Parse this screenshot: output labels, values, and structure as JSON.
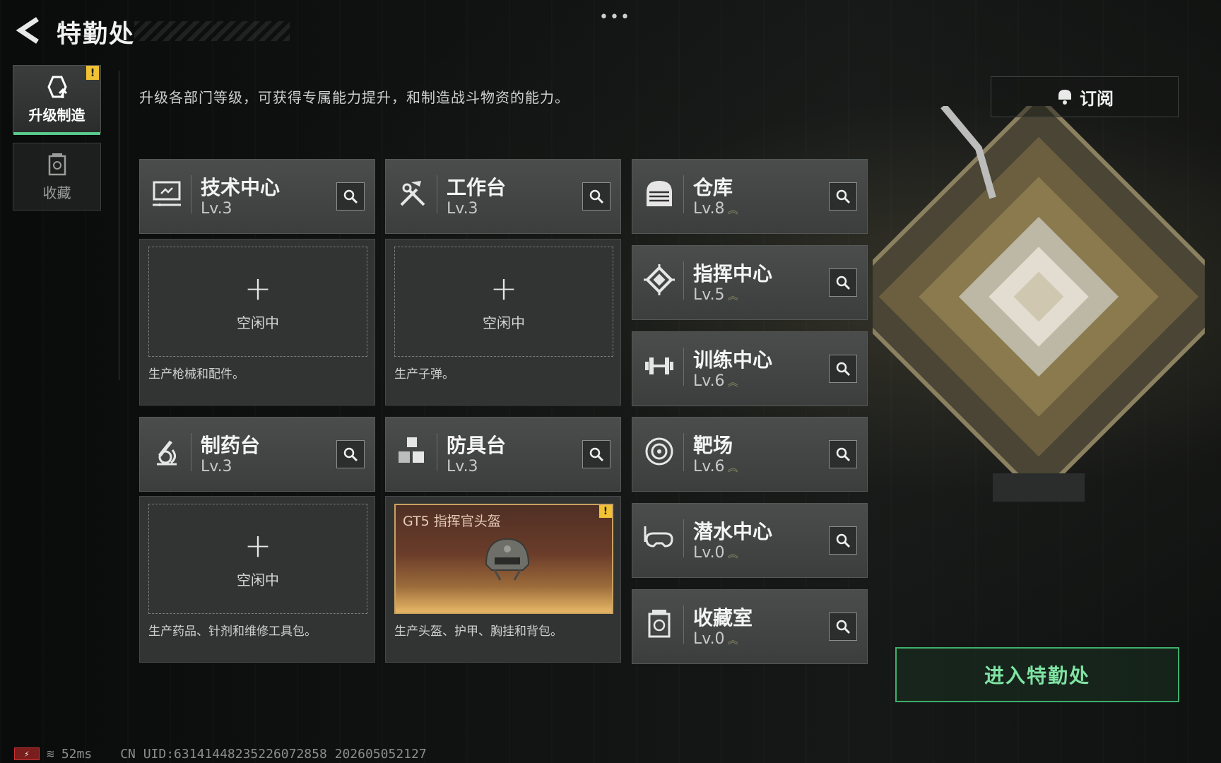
{
  "header": {
    "title": "特勤处",
    "more_dots": "•••"
  },
  "tabs": [
    {
      "label": "升级制造",
      "active": true,
      "warning": "!"
    },
    {
      "label": "收藏",
      "active": false
    }
  ],
  "description": "升级各部门等级，可获得专属能力提升，和制造战斗物资的能力。",
  "subscribe_label": "订阅",
  "enter_label": "进入特勤处",
  "stations": [
    {
      "name": "技术中心",
      "level": "Lv.3",
      "icon": "computer-icon",
      "slot_status": "空闲中",
      "slot_desc": "生产枪械和配件。"
    },
    {
      "name": "工作台",
      "level": "Lv.3",
      "icon": "tools-icon",
      "slot_status": "空闲中",
      "slot_desc": "生产子弹。"
    },
    {
      "name": "制药台",
      "level": "Lv.3",
      "icon": "microscope-icon",
      "slot_status": "空闲中",
      "slot_desc": "生产药品、针剂和维修工具包。"
    },
    {
      "name": "防具台",
      "level": "Lv.3",
      "icon": "cubes-icon",
      "slot_item": "GT5 指挥官头盔",
      "slot_warning": "!",
      "slot_desc": "生产头盔、护甲、胸挂和背包。"
    }
  ],
  "facilities": [
    {
      "name": "仓库",
      "level": "Lv.8",
      "icon": "warehouse-icon"
    },
    {
      "name": "指挥中心",
      "level": "Lv.5",
      "icon": "command-icon"
    },
    {
      "name": "训练中心",
      "level": "Lv.6",
      "icon": "dumbbell-icon"
    },
    {
      "name": "靶场",
      "level": "Lv.6",
      "icon": "target-icon"
    },
    {
      "name": "潜水中心",
      "level": "Lv.0",
      "icon": "diving-mask-icon"
    },
    {
      "name": "收藏室",
      "level": "Lv.0",
      "icon": "collection-icon"
    }
  ],
  "status_bar": {
    "ping": "52ms",
    "uid": "CN UID:63141448235226072858 202605052127"
  },
  "colors": {
    "accent_green": "#3fae6a",
    "warning_yellow": "#f1c232",
    "helmet_gold": "#caa260"
  }
}
